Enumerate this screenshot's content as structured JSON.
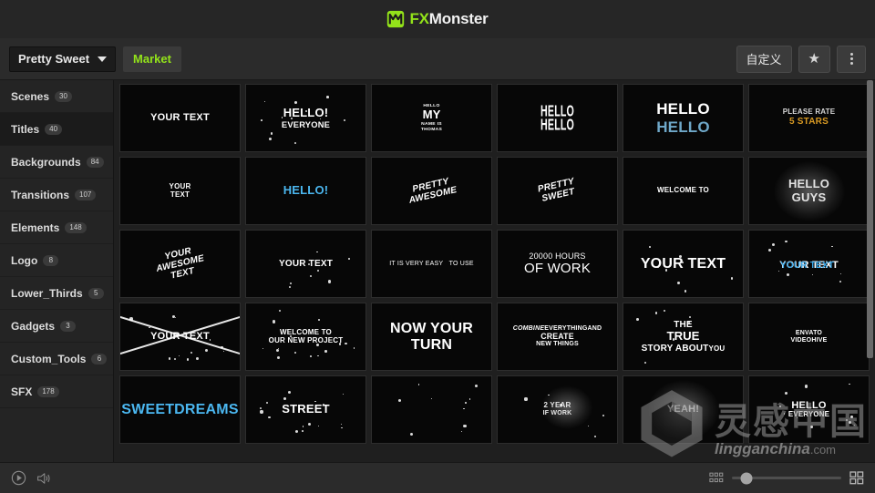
{
  "header": {
    "logo_fx": "FX",
    "logo_rest": "Monster",
    "logo_icon": "monster-logo-icon"
  },
  "toolbar": {
    "project_name": "Pretty Sweet",
    "market_tab": "Market",
    "customize_label": "自定义",
    "favorite_icon": "star-icon",
    "more_icon": "kebab-menu-icon"
  },
  "sidebar": {
    "items": [
      {
        "label": "Scenes",
        "count": "30",
        "active": false
      },
      {
        "label": "Titles",
        "count": "40",
        "active": true
      },
      {
        "label": "Backgrounds",
        "count": "84",
        "active": false
      },
      {
        "label": "Transitions",
        "count": "107",
        "active": false
      },
      {
        "label": "Elements",
        "count": "148",
        "active": false
      },
      {
        "label": "Logo",
        "count": "8",
        "active": false
      },
      {
        "label": "Lower_Thirds",
        "count": "5",
        "active": false
      },
      {
        "label": "Gadgets",
        "count": "3",
        "active": false
      },
      {
        "label": "Custom_Tools",
        "count": "6",
        "active": false
      },
      {
        "label": "SFX",
        "count": "178",
        "active": false
      }
    ]
  },
  "grid": {
    "items": [
      {
        "id": "t1",
        "lines": [
          "YOUR TEXT"
        ],
        "style": "plain",
        "size": "s11"
      },
      {
        "id": "t2",
        "lines": [
          "HELLO!",
          "EVERYONE"
        ],
        "style": "stack-splat",
        "size": "s13"
      },
      {
        "id": "t3",
        "lines": [
          "HELLO",
          "MY",
          "NAME IS",
          "THOMAS"
        ],
        "style": "name-card",
        "size": "s8"
      },
      {
        "id": "t4",
        "lines": [
          "HELLO",
          "HELLO"
        ],
        "style": "distort",
        "size": "s13"
      },
      {
        "id": "t5",
        "lines": [
          "HELLO",
          "HELLO"
        ],
        "style": "glitch-blue",
        "size": "s13"
      },
      {
        "id": "t6",
        "lines": [
          "PLEASE RATE",
          "5 STARS"
        ],
        "style": "gold-rate",
        "size": "s8"
      },
      {
        "id": "t7",
        "lines": [
          "YOUR",
          "TEXT"
        ],
        "style": "plain-stack",
        "size": "s8"
      },
      {
        "id": "t8",
        "lines": [
          "HELLO!"
        ],
        "style": "blue-bold",
        "size": "s13"
      },
      {
        "id": "t9",
        "lines": [
          "PRETTY",
          "AWESOME"
        ],
        "style": "rotated",
        "size": "s10"
      },
      {
        "id": "t10",
        "lines": [
          "PRETTY",
          "SWEET"
        ],
        "style": "rotated",
        "size": "s10"
      },
      {
        "id": "t11",
        "lines": [
          "WELCOME TO"
        ],
        "style": "plain",
        "size": "s8"
      },
      {
        "id": "t12",
        "lines": [
          "HELLO",
          "GUYS"
        ],
        "style": "smoke",
        "size": "s13"
      },
      {
        "id": "t13",
        "lines": [
          "YOUR",
          "AWESOME",
          "TEXT"
        ],
        "style": "rotated",
        "size": "s10"
      },
      {
        "id": "t14",
        "lines": [
          "YOUR TEXT"
        ],
        "style": "speckle",
        "size": "s10"
      },
      {
        "id": "t15",
        "lines": [
          "IT IS VERY EASY",
          "TO USE"
        ],
        "style": "thin-row",
        "size": "s7"
      },
      {
        "id": "t16",
        "lines": [
          "20000 HOURS",
          "OF WORK"
        ],
        "style": "hours",
        "size": "s8"
      },
      {
        "id": "t17",
        "lines": [
          "YOUR TEXT"
        ],
        "style": "speckle",
        "size": "s9"
      },
      {
        "id": "t18",
        "lines": [
          "YOUR TEXT"
        ],
        "style": "glitch-blue-single",
        "size": "s10"
      },
      {
        "id": "t19",
        "lines": [
          "YOUR TEXT"
        ],
        "style": "crossed",
        "size": "s11"
      },
      {
        "id": "t20",
        "lines": [
          "WELCOME TO",
          "OUR NEW PROJECT"
        ],
        "style": "grunge",
        "size": "s8"
      },
      {
        "id": "t21",
        "lines": [
          "NOW YOUR TURN"
        ],
        "style": "plain",
        "size": "s9"
      },
      {
        "id": "t22",
        "lines": [
          "COMBINE",
          "EVERYTHING",
          "AND",
          "CREATE",
          "NEW THINGS"
        ],
        "style": "combine",
        "size": "s7"
      },
      {
        "id": "t23",
        "lines": [
          "THE",
          "TRUE",
          "STORY ABOUT",
          "YOU"
        ],
        "style": "true-story",
        "size": "s8"
      },
      {
        "id": "t24",
        "lines": [
          "ENVATO",
          "VIDEOHIVE"
        ],
        "style": "plain-stack",
        "size": "s7"
      },
      {
        "id": "t25",
        "lines": [
          "SWEET",
          "DREAMS"
        ],
        "style": "blue-stack",
        "size": "s9"
      },
      {
        "id": "t26",
        "lines": [
          "STREET"
        ],
        "style": "grunge",
        "size": "s13"
      },
      {
        "id": "t27",
        "lines": [
          ""
        ],
        "style": "fragment",
        "size": "s8"
      },
      {
        "id": "t28",
        "lines": [
          "2 YEAR",
          "IF WORK"
        ],
        "style": "swirl",
        "size": "s8"
      },
      {
        "id": "t29",
        "lines": [
          "YEAH!"
        ],
        "style": "smoke",
        "size": "s11"
      },
      {
        "id": "t30",
        "lines": [
          "HELLO",
          "EVERYONE"
        ],
        "style": "stack-splat",
        "size": "s11"
      }
    ],
    "partial_row_count": 6
  },
  "watermark": {
    "cn": "灵感中国",
    "url": "lingganchina",
    "tld": ".com"
  },
  "footer": {
    "play_icon": "play-circle-icon",
    "volume_icon": "speaker-icon",
    "small_grid_icon": "small-grid-icon",
    "large_grid_icon": "large-grid-icon",
    "zoom_value": "0"
  },
  "colors": {
    "accent_green": "#93e31a",
    "accent_blue": "#4bb7f0",
    "gold": "#d99a23"
  }
}
